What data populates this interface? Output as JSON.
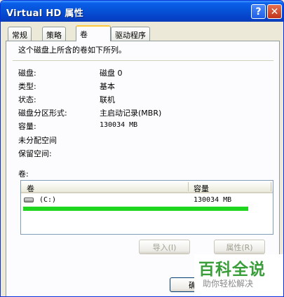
{
  "window": {
    "title": "Virtual HD 属性",
    "help_glyph": "?",
    "close_glyph": "✕"
  },
  "tabs": [
    {
      "label": "常规",
      "active": false
    },
    {
      "label": "策略",
      "active": false
    },
    {
      "label": "卷",
      "active": true
    },
    {
      "label": "驱动程序",
      "active": false
    }
  ],
  "volumes_tab": {
    "description": "这个磁盘上所含的卷如下所列。",
    "properties": [
      {
        "label": "磁盘:",
        "value": "磁盘 0"
      },
      {
        "label": "类型:",
        "value": "基本"
      },
      {
        "label": "状态:",
        "value": "联机"
      },
      {
        "label": "磁盘分区形式:",
        "value": "主启动记录(MBR)"
      },
      {
        "label": "容量:",
        "value": "130034 MB"
      },
      {
        "label": "未分配空间",
        "value": ""
      },
      {
        "label": "保留空间:",
        "value": ""
      }
    ],
    "volumes_label": "卷:",
    "list": {
      "columns": [
        "卷",
        "容量"
      ],
      "rows": [
        {
          "volume": "(C:)",
          "capacity": "130034 MB",
          "icon": "drive-icon"
        }
      ]
    },
    "import_button": "导入(I)",
    "properties_button": "属性(R)"
  },
  "footer": {
    "ok_button_partial": "确"
  },
  "watermark": {
    "title": "百科全说",
    "subtitle": "助你轻松解决"
  },
  "colors": {
    "titlebar": "#0651d6",
    "highlight_mark": "#1fd61f",
    "watermark_green": "#3a9e3a"
  }
}
